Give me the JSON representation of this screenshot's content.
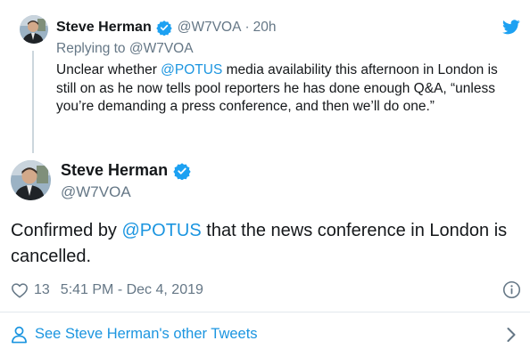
{
  "parent_tweet": {
    "author_name": "Steve Herman",
    "handle": "@W7VOA",
    "separator": "·",
    "time_ago": "20h",
    "replying_prefix": "Replying to",
    "replying_to": "@W7VOA",
    "text_part1": "Unclear whether ",
    "mention": "@POTUS",
    "text_part2": " media availability this afternoon in London is still on as he now tells pool reporters he has done enough Q&A, “unless you’re demanding a press conference, and then we’ll do one.”"
  },
  "main_tweet": {
    "author_name": "Steve Herman",
    "handle": "@W7VOA",
    "text_part1": "Confirmed by ",
    "mention": "@POTUS",
    "text_part2": " that the news conference in London is cancelled.",
    "like_count": "13",
    "timestamp": "5:41 PM - Dec 4, 2019"
  },
  "footer": {
    "see_more_label": "See Steve Herman's other Tweets"
  },
  "icons": {
    "bird": "twitter-bird-icon",
    "verified": "verified-badge-icon",
    "like": "heart-icon",
    "info": "info-icon",
    "person": "person-icon",
    "chevron": "chevron-right-icon"
  },
  "colors": {
    "brand_blue": "#1da1f2",
    "link_blue": "#1b95e0",
    "text_primary": "#14171a",
    "text_secondary": "#657786",
    "divider": "#e1e8ed"
  }
}
